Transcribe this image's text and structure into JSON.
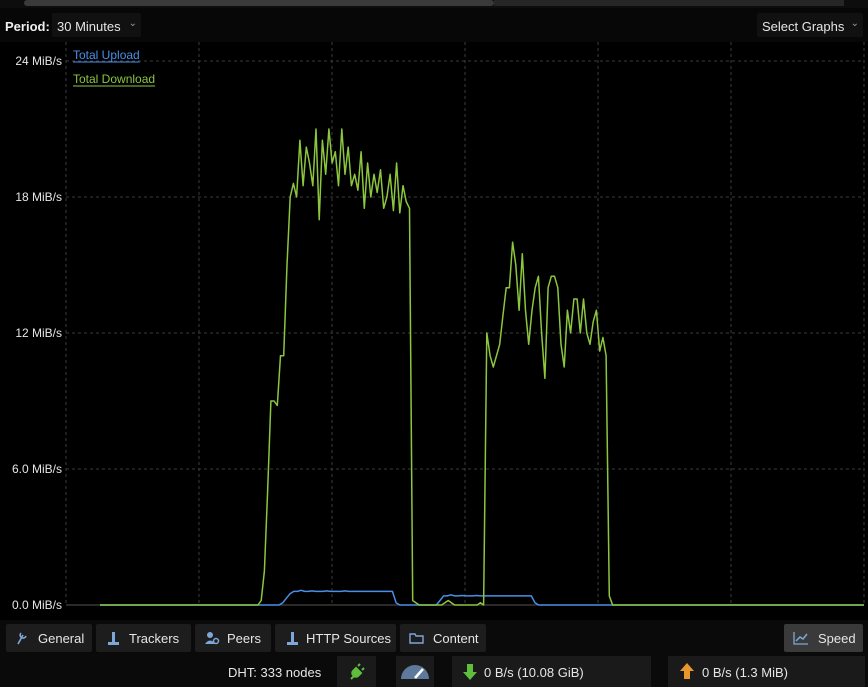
{
  "toolbar": {
    "period_label": "Period:",
    "period_value": "30 Minutes",
    "graphs_button": "Select Graphs"
  },
  "chart_data": {
    "type": "line",
    "ylabel_ticks": [
      "24 MiB/s",
      "18 MiB/s",
      "12 MiB/s",
      "6.0 MiB/s",
      "0.0 MiB/s"
    ],
    "ylim": [
      0,
      24
    ],
    "y_unit": "MiB/s",
    "grid": true,
    "legend_placement": "top-left",
    "series": [
      {
        "name": "Total Upload",
        "color": "#4a8fe7",
        "values": [
          0,
          0,
          0,
          0,
          0,
          0,
          0,
          0,
          0,
          0,
          0,
          0,
          0,
          0,
          0,
          0,
          0,
          0,
          0,
          0,
          0,
          0,
          0,
          0,
          0,
          0,
          0,
          0,
          0,
          0,
          0,
          0,
          0,
          0,
          0,
          0,
          0,
          0,
          0,
          0,
          0,
          0,
          0,
          0,
          0,
          0,
          0,
          0,
          0,
          0,
          0.1,
          0.3,
          0.5,
          0.6,
          0.6,
          0.65,
          0.6,
          0.6,
          0.62,
          0.6,
          0.6,
          0.6,
          0.62,
          0.6,
          0.6,
          0.6,
          0.6,
          0.62,
          0.6,
          0.6,
          0.6,
          0.6,
          0.6,
          0.6,
          0.6,
          0.6,
          0.6,
          0.6,
          0.6,
          0.6,
          0.6,
          0.1,
          0,
          0,
          0,
          0,
          0,
          0,
          0,
          0,
          0,
          0,
          0,
          0.2,
          0.4,
          0.4,
          0.45,
          0.4,
          0.4,
          0.42,
          0.4,
          0.4,
          0.4,
          0.42,
          0.4,
          0.4,
          0.4,
          0.4,
          0.4,
          0.4,
          0.4,
          0.4,
          0.4,
          0.4,
          0.4,
          0.4,
          0.4,
          0.4,
          0.4,
          0.1,
          0,
          0,
          0,
          0,
          0,
          0,
          0,
          0,
          0,
          0,
          0,
          0,
          0,
          0,
          0,
          0,
          0,
          0,
          0,
          0,
          0,
          0,
          0,
          0,
          0,
          0,
          0,
          0,
          0,
          0,
          0,
          0,
          0,
          0,
          0,
          0,
          0,
          0,
          0,
          0,
          0,
          0,
          0,
          0,
          0,
          0,
          0,
          0,
          0,
          0,
          0,
          0,
          0,
          0,
          0,
          0,
          0,
          0,
          0,
          0,
          0,
          0,
          0,
          0,
          0,
          0,
          0,
          0,
          0,
          0,
          0,
          0,
          0,
          0,
          0,
          0,
          0,
          0,
          0,
          0,
          0,
          0,
          0,
          0,
          0,
          0,
          0,
          0,
          0,
          0
        ]
      },
      {
        "name": "Total Download",
        "color": "#8cc63e",
        "values": [
          0,
          0,
          0,
          0,
          0,
          0,
          0,
          0,
          0,
          0,
          0,
          0,
          0,
          0,
          0,
          0,
          0,
          0,
          0,
          0,
          0,
          0,
          0,
          0,
          0,
          0,
          0,
          0,
          0,
          0,
          0,
          0,
          0,
          0,
          0,
          0,
          0,
          0,
          0,
          0,
          0,
          0,
          0,
          0,
          0,
          0,
          0,
          0,
          0,
          0,
          0.2,
          1.5,
          5,
          9,
          9,
          8.8,
          11,
          11,
          15,
          18,
          18.6,
          18,
          20.5,
          18.5,
          20.2,
          19.5,
          18.5,
          21,
          17,
          20.5,
          19,
          21,
          19.5,
          20,
          18.5,
          21,
          19,
          20.2,
          18.5,
          19,
          18.3,
          20,
          17.5,
          19.5,
          18,
          19,
          18.2,
          19.2,
          17.5,
          18,
          19,
          17.4,
          19.5,
          17.3,
          18.5,
          17.8,
          17.5,
          0.2,
          0.1,
          0,
          0,
          0,
          0,
          0,
          0,
          0,
          0,
          0.1,
          0.2,
          0.1,
          0,
          0,
          0,
          0,
          0,
          0,
          0,
          0,
          0.1,
          0,
          12,
          11,
          10.5,
          11,
          11.5,
          12.8,
          14,
          14,
          16,
          15,
          13,
          15.5,
          13,
          11.5,
          13,
          14,
          14.5,
          12,
          10,
          14,
          14.5,
          14.5,
          14,
          11.5,
          10.5,
          13,
          12,
          13.5,
          13.5,
          12,
          13.5,
          12,
          11.5,
          12.5,
          13,
          11.2,
          11.8,
          11,
          0.4,
          0,
          0,
          0,
          0,
          0,
          0,
          0,
          0,
          0,
          0,
          0,
          0,
          0,
          0,
          0,
          0,
          0,
          0,
          0,
          0,
          0,
          0,
          0,
          0,
          0,
          0,
          0,
          0,
          0,
          0,
          0,
          0,
          0,
          0,
          0,
          0,
          0,
          0,
          0,
          0,
          0,
          0,
          0,
          0,
          0,
          0,
          0,
          0,
          0,
          0,
          0,
          0,
          0,
          0,
          0,
          0,
          0,
          0,
          0,
          0,
          0,
          0,
          0,
          0,
          0,
          0,
          0,
          0,
          0,
          0,
          0,
          0,
          0,
          0,
          0,
          0,
          0,
          0,
          0
        ]
      }
    ]
  },
  "tabs": [
    {
      "label": "General",
      "icon": "general-icon"
    },
    {
      "label": "Trackers",
      "icon": "trackers-icon"
    },
    {
      "label": "Peers",
      "icon": "peers-icon"
    },
    {
      "label": "HTTP Sources",
      "icon": "http-sources-icon"
    },
    {
      "label": "Content",
      "icon": "folder-icon"
    },
    {
      "label": "Speed",
      "icon": "speed-icon"
    }
  ],
  "status": {
    "dht": "DHT: 333 nodes",
    "download": "0 B/s (10.08 GiB)",
    "upload": "0 B/s (1.3 MiB)"
  }
}
